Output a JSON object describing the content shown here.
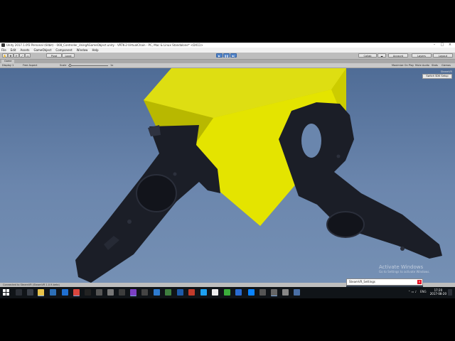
{
  "window": {
    "title": "Unity 2017.1.0f3 Personal (64bit) - 008_Controller_UsingAGameObject.unity - VRTK-2-VirtualChain - PC, Mac & Linux Standalone* <DX11>"
  },
  "menu": [
    "File",
    "Edit",
    "Assets",
    "GameObject",
    "Component",
    "Window",
    "Help"
  ],
  "toolbar": {
    "pivot_label": "Pivot",
    "local_label": "Local",
    "collab_label": "Collab",
    "account_label": "Account",
    "layers_label": "Layers",
    "layout_label": "Layout"
  },
  "game_view": {
    "tab_label": "Game",
    "display_label": "Display 1",
    "aspect_label": "Free Aspect",
    "scale_label": "Scale",
    "scale_value": "1x",
    "maximize_label": "Maximize On Play",
    "mute_label": "Mute Audio",
    "stats_label": "Stats",
    "gizmos_label": "Gizmos"
  },
  "steamvr": {
    "panel_label": "SteamVR",
    "switch_button": "Switch SDK Setup"
  },
  "status": {
    "text": "Connected to SteamVR (SteamVR 1.0.9-beta)"
  },
  "popup": {
    "title": "SteamVR_Settings",
    "close_label": "×"
  },
  "watermark": {
    "line1": "Activate Windows",
    "line2": "Go to Settings to activate Windows."
  },
  "taskbar": {
    "language": "ENG",
    "time": "17:20",
    "date": "2017-08-20"
  },
  "colors": {
    "sky_top": "#4f6c96",
    "cube": "#d8d800",
    "controller": "#1a1d26",
    "play_blue": "#4f82c8",
    "taskbar": "#101418"
  },
  "taskbar_icons": [
    "windows-start",
    "task-view",
    "file-explorer",
    "edge",
    "photoshop",
    "word",
    "excel",
    "chrome",
    "terminal",
    "settings",
    "vs-code",
    "visual-studio",
    "unity",
    "git",
    "steam",
    "media",
    "notepad",
    "twitter",
    "vlc",
    "mail",
    "ps",
    "xbox",
    "search",
    "app-a",
    "app-b",
    "app-c"
  ]
}
